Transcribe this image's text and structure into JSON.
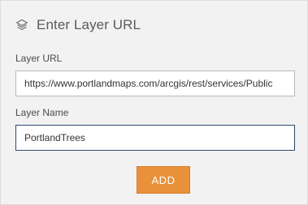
{
  "header": {
    "title": "Enter Layer URL",
    "icon": "layers-icon"
  },
  "form": {
    "url_label": "Layer URL",
    "url_value": "https://www.portlandmaps.com/arcgis/rest/services/Public",
    "name_label": "Layer Name",
    "name_value": "PortlandTrees",
    "add_label": "ADD"
  },
  "colors": {
    "panel_background": "#f2f2f2",
    "accent_button": "#e8903a",
    "focused_border": "#2d4a6e"
  }
}
